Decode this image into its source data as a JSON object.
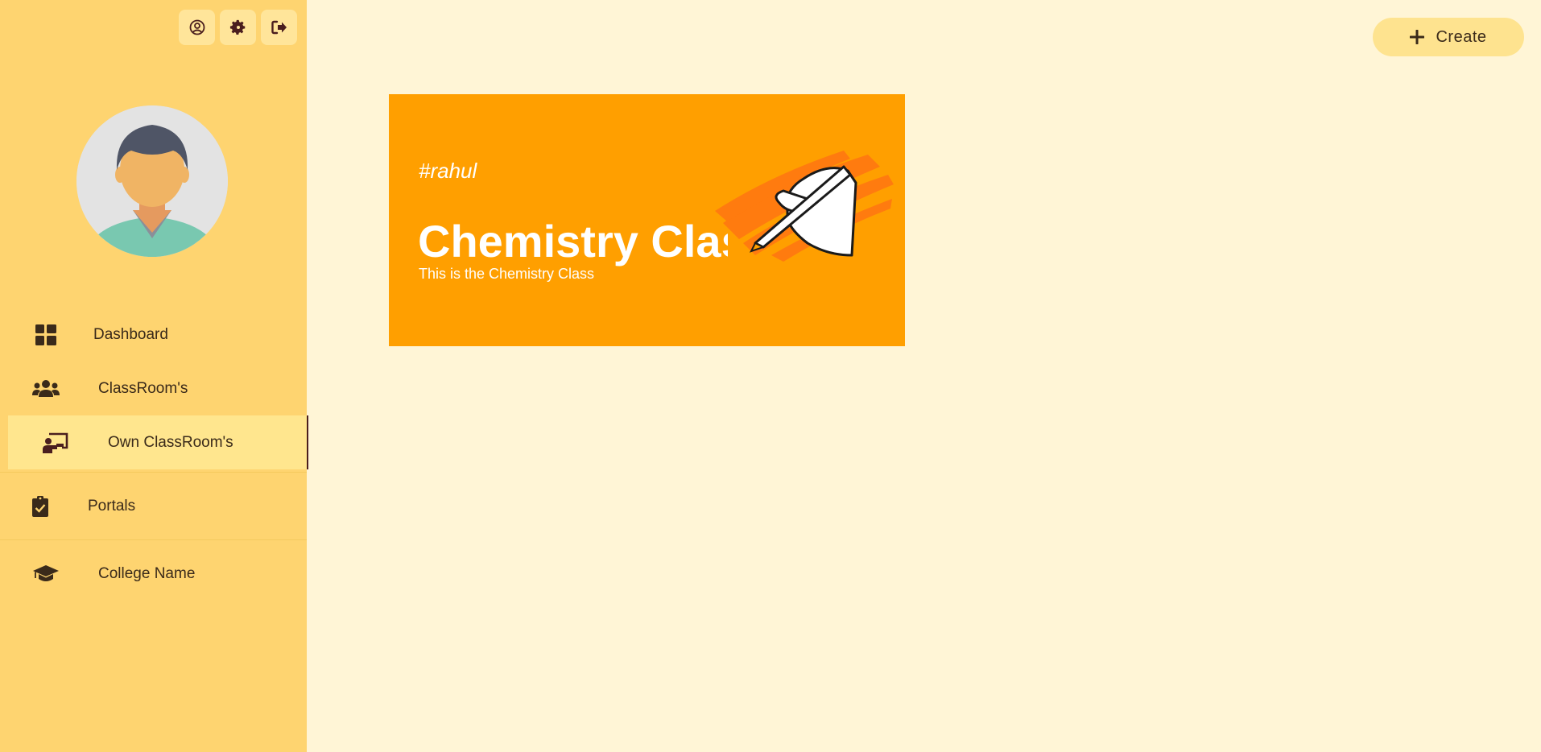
{
  "sidebar": {
    "top_icons": [
      "user-circle-icon",
      "gear-icon",
      "sign-out-icon"
    ],
    "items": [
      {
        "label": "Dashboard",
        "icon": "grid-icon"
      },
      {
        "label": "ClassRoom's",
        "icon": "users-icon"
      },
      {
        "label": "Own ClassRoom's",
        "icon": "chalkboard-teacher-icon",
        "active": true
      },
      {
        "label": "Portals",
        "icon": "clipboard-check-icon"
      },
      {
        "label": "College Name",
        "icon": "graduation-cap-icon"
      }
    ]
  },
  "header": {
    "create_label": "Create"
  },
  "classes": [
    {
      "tag": "#rahul",
      "title": "Chemistry Class",
      "description": "This is the Chemistry Class"
    }
  ],
  "colors": {
    "sidebar_bg": "#fed470",
    "page_bg": "#fff5d6",
    "card_bg": "#ff9f00",
    "active_item_bg": "#ffe68e",
    "icon_color": "#4a1e1e"
  }
}
